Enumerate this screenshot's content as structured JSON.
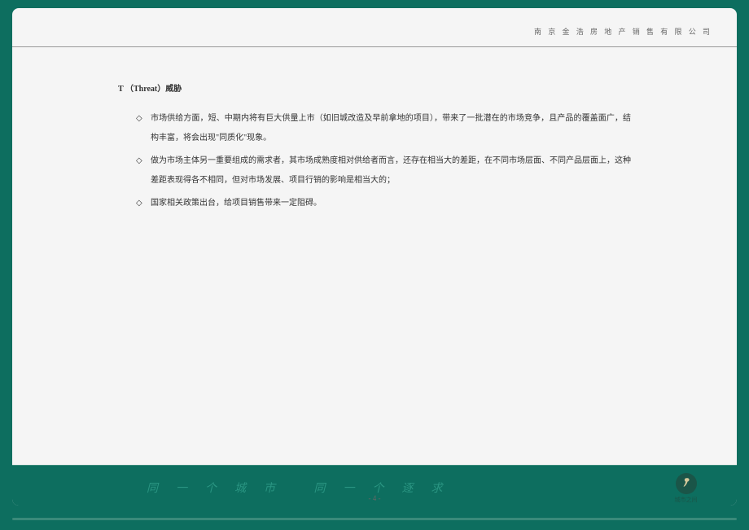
{
  "header": {
    "company": "南 京 金 浩 房 地 产 销 售 有 限 公 司"
  },
  "content": {
    "sectionTitle": "T （Threat）威胁",
    "bullets": [
      "市场供给方面，短、中期内将有巨大供量上市（如旧城改造及早前拿地的项目），带来了一批潜在的市场竞争，且产品的覆盖面广，结构丰富，将会出现\"同质化\"现象。",
      "做为市场主体另一重要组成的需求者，其市场成熟度相对供给者而言，还存在相当大的差距，在不同市场层面、不同产品层面上，这种差距表现得各不相同，但对市场发展、项目行销的影响是相当大的；",
      "国家相关政策出台，给项目销售带来一定阻碍。"
    ],
    "bulletMarker": "◇"
  },
  "footer": {
    "slogan": "同一个城市  同一个逐求",
    "logoText": "城市之间",
    "pageNumber": "- 4 -"
  }
}
